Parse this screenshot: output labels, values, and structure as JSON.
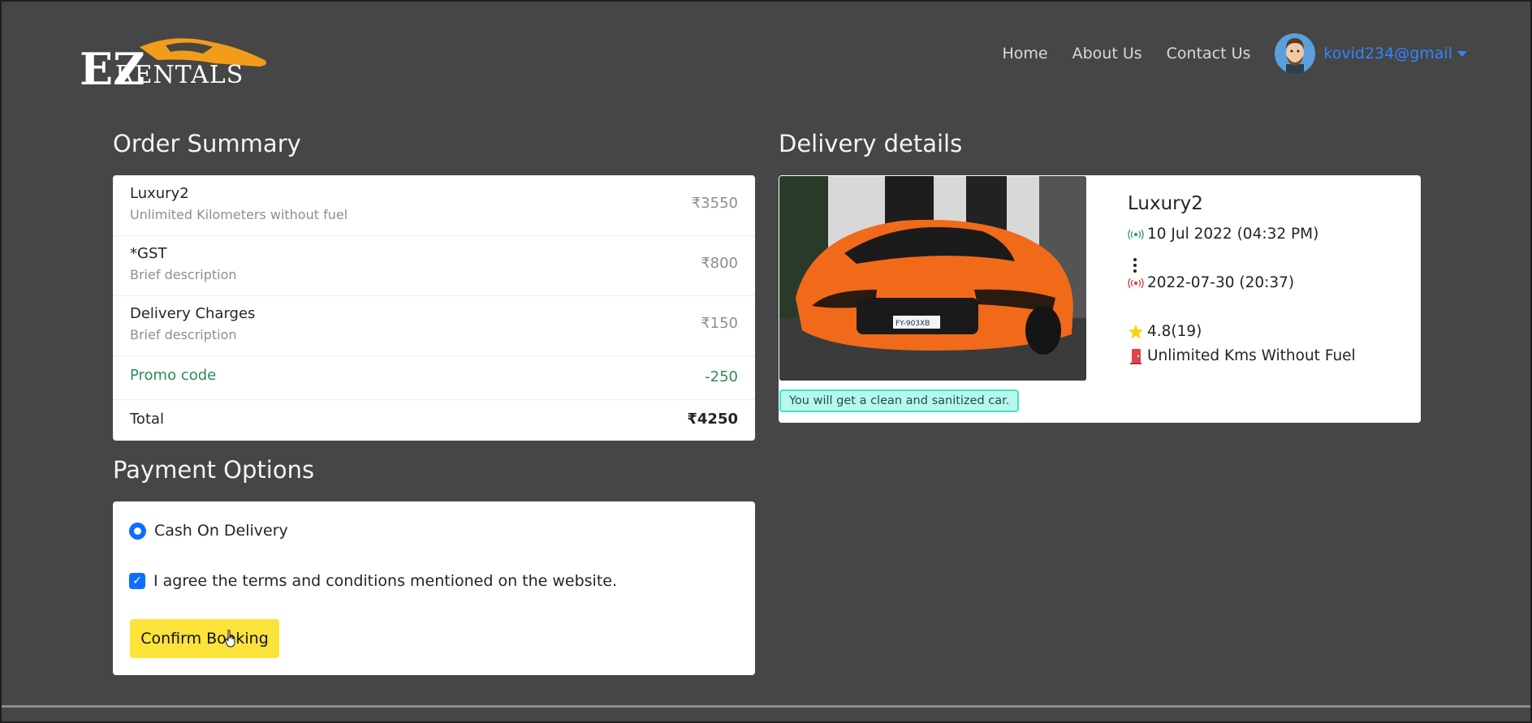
{
  "header": {
    "logo_text": "RENTALS",
    "logo_letters": "EZ",
    "nav": [
      {
        "label": "Home"
      },
      {
        "label": "About Us"
      },
      {
        "label": "Contact Us"
      }
    ],
    "user_email": "kovid234@gmail"
  },
  "order_summary": {
    "title": "Order Summary",
    "items": [
      {
        "name": "Luxury2",
        "desc": "Unlimited Kilometers without fuel",
        "price": "₹3550"
      },
      {
        "name": "*GST",
        "desc": "Brief description",
        "price": "₹800"
      },
      {
        "name": "Delivery Charges",
        "desc": "Brief description",
        "price": "₹150"
      }
    ],
    "promo": {
      "label": "Promo code",
      "value": "-250"
    },
    "total": {
      "label": "Total",
      "value": "₹4250"
    }
  },
  "payment": {
    "title": "Payment Options",
    "method": "Cash On Delivery",
    "terms": "I agree the terms and conditions mentioned on the website.",
    "confirm_label": "Confirm Booking"
  },
  "delivery": {
    "title": "Delivery details",
    "car_name": "Luxury2",
    "start": "10 Jul 2022 (04:32 PM)",
    "end": "2022-07-30 (20:37)",
    "rating": "4.8(19)",
    "plan": "Unlimited Kms Without Fuel",
    "badge": "You will get a clean and sanitized car.",
    "plate": "FY-903XB"
  },
  "colors": {
    "background": "#464646",
    "accent_blue": "#0d6efd",
    "button_yellow": "#fbe33a",
    "promo_green": "#2d8a57",
    "car_orange": "#f06a1a"
  }
}
